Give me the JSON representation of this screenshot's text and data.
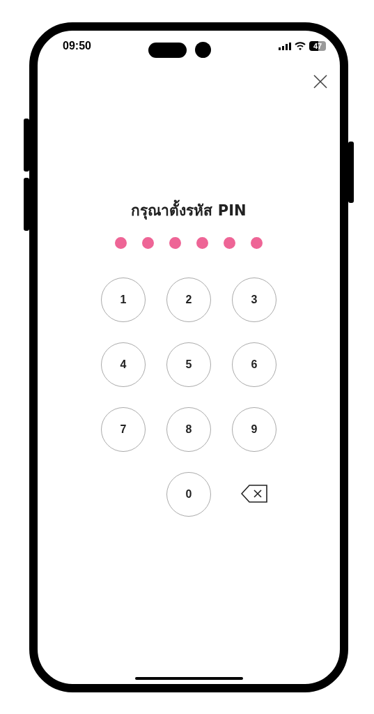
{
  "status_bar": {
    "time": "09:50",
    "battery": "47"
  },
  "title": "กรุณาตั้งรหัส PIN",
  "pin_dots": [
    {
      "filled": true
    },
    {
      "filled": true
    },
    {
      "filled": true
    },
    {
      "filled": true
    },
    {
      "filled": true
    },
    {
      "filled": true
    }
  ],
  "keypad": [
    {
      "kind": "digit",
      "label": "1"
    },
    {
      "kind": "digit",
      "label": "2"
    },
    {
      "kind": "digit",
      "label": "3"
    },
    {
      "kind": "digit",
      "label": "4"
    },
    {
      "kind": "digit",
      "label": "5"
    },
    {
      "kind": "digit",
      "label": "6"
    },
    {
      "kind": "digit",
      "label": "7"
    },
    {
      "kind": "digit",
      "label": "8"
    },
    {
      "kind": "digit",
      "label": "9"
    },
    {
      "kind": "blank"
    },
    {
      "kind": "digit",
      "label": "0"
    },
    {
      "kind": "delete"
    }
  ]
}
